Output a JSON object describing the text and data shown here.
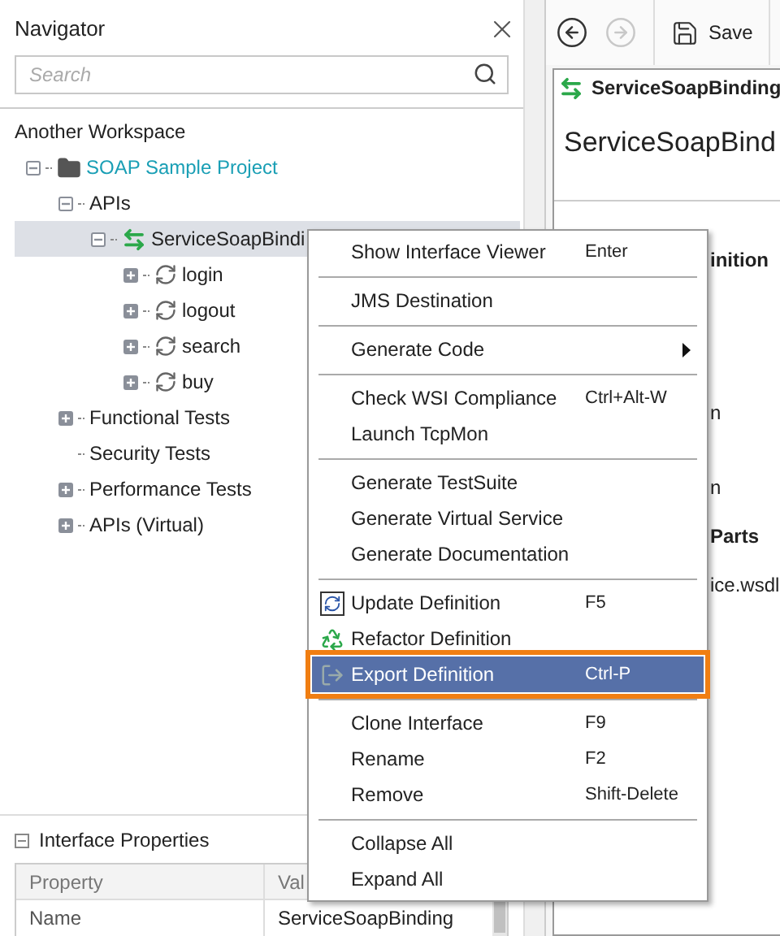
{
  "navigator": {
    "title": "Navigator",
    "search": {
      "placeholder": "Search"
    },
    "workspace": "Another Workspace",
    "tree": [
      {
        "label": "SOAP Sample Project",
        "kind": "project",
        "expanded": true,
        "selected": false,
        "children": [
          {
            "label": "APIs",
            "expanded": true,
            "selected": false,
            "children": [
              {
                "label": "ServiceSoapBindi",
                "kind": "interface",
                "expanded": true,
                "selected": true,
                "children": [
                  {
                    "label": "login",
                    "kind": "operation",
                    "expanded": false,
                    "selected": false
                  },
                  {
                    "label": "logout",
                    "kind": "operation",
                    "expanded": false,
                    "selected": false
                  },
                  {
                    "label": "search",
                    "kind": "operation",
                    "expanded": false,
                    "selected": false
                  },
                  {
                    "label": "buy",
                    "kind": "operation",
                    "expanded": false,
                    "selected": false
                  }
                ]
              }
            ]
          },
          {
            "label": "Functional Tests",
            "expanded": false,
            "selected": false
          },
          {
            "label": "Security Tests",
            "selected": false
          },
          {
            "label": "Performance Tests",
            "expanded": false,
            "selected": false
          },
          {
            "label": "APIs (Virtual)",
            "expanded": false,
            "selected": false
          }
        ]
      }
    ]
  },
  "properties": {
    "title": "Interface Properties",
    "expanded": true,
    "columns": [
      "Property",
      "Val"
    ],
    "rows": [
      [
        "Name",
        "ServiceSoapBinding"
      ]
    ]
  },
  "toolbar": {
    "back": {
      "disabled": false
    },
    "forward": {
      "disabled": true
    },
    "save": "Save"
  },
  "editor": {
    "tab": "ServiceSoapBinding",
    "heading": "ServiceSoapBind",
    "fragments": [
      {
        "text": "inition",
        "bold": true
      },
      {
        "text": "n",
        "bold": false
      },
      {
        "text": "n",
        "bold": false
      },
      {
        "text": "Parts",
        "bold": true
      },
      {
        "text": "ice.wsdl",
        "bold": false
      }
    ]
  },
  "context_menu": {
    "groups": [
      {
        "items": [
          {
            "label": "Show Interface Viewer",
            "shortcut": "Enter",
            "selected": false
          }
        ]
      },
      {
        "separator": true,
        "items": [
          {
            "label": "JMS Destination",
            "selected": false
          }
        ]
      },
      {
        "separator": true,
        "items": [
          {
            "label": "Generate Code",
            "submenu": true,
            "selected": false
          }
        ]
      },
      {
        "separator": true,
        "items": [
          {
            "label": "Check WSI Compliance",
            "shortcut": "Ctrl+Alt-W",
            "selected": false
          },
          {
            "label": "Launch TcpMon",
            "selected": false
          }
        ]
      },
      {
        "separator": true,
        "items": [
          {
            "label": "Generate TestSuite",
            "selected": false
          },
          {
            "label": "Generate Virtual Service",
            "selected": false
          },
          {
            "label": "Generate Documentation",
            "selected": false
          }
        ]
      },
      {
        "separator": true,
        "items": [
          {
            "label": "Update Definition",
            "kind": "update",
            "shortcut": "F5",
            "selected": false
          },
          {
            "label": "Refactor Definition",
            "kind": "refactor",
            "selected": false
          },
          {
            "label": "Export Definition",
            "kind": "export",
            "shortcut": "Ctrl-P",
            "selected": true
          }
        ]
      },
      {
        "separator": true,
        "items": [
          {
            "label": "Clone Interface",
            "shortcut": "F9",
            "selected": false
          },
          {
            "label": "Rename",
            "shortcut": "F2",
            "selected": false
          },
          {
            "label": "Remove",
            "shortcut": "Shift-Delete",
            "selected": false
          }
        ]
      },
      {
        "separator": true,
        "items": [
          {
            "label": "Collapse All",
            "selected": false
          },
          {
            "label": "Expand All",
            "selected": false
          }
        ]
      }
    ]
  }
}
